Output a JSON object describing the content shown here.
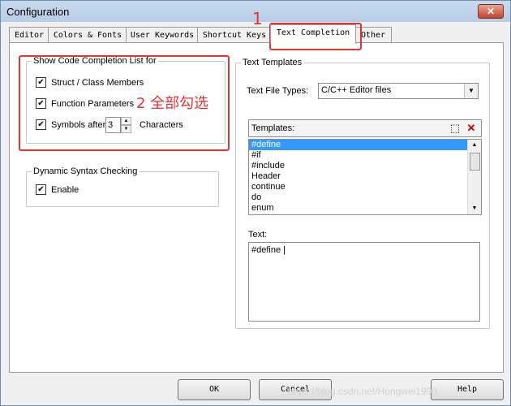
{
  "window": {
    "title": "Configuration",
    "close_symbol": "✕"
  },
  "tabs": [
    {
      "label": "Editor",
      "active": false
    },
    {
      "label": "Colors & Fonts",
      "active": false
    },
    {
      "label": "User Keywords",
      "active": false
    },
    {
      "label": "Shortcut Keys",
      "active": false
    },
    {
      "label": "Text Completion",
      "active": true
    },
    {
      "label": "Other",
      "active": false
    }
  ],
  "completion_group": {
    "legend": "Show Code Completion List for",
    "items": [
      {
        "label": "Struct / Class Members",
        "checked": true
      },
      {
        "label": "Function Parameters",
        "checked": true
      },
      {
        "label": "Symbols after",
        "checked": true
      }
    ],
    "symbols_count": "3",
    "characters_label": "Characters"
  },
  "syntax_group": {
    "legend": "Dynamic Syntax Checking",
    "enable_label": "Enable",
    "enable_checked": true
  },
  "templates_group": {
    "legend": "Text Templates",
    "file_types_label": "Text File Types:",
    "file_types_value": "C/C++ Editor files",
    "templates_label": "Templates:",
    "templates": [
      "#define",
      "#if",
      "#include",
      "Header",
      "continue",
      "do",
      "enum"
    ],
    "selected_template": "#define",
    "text_label": "Text:",
    "text_value": "#define |"
  },
  "buttons": {
    "ok": "OK",
    "cancel": "Cancel",
    "help": "Help"
  },
  "annotations": {
    "step1": "1",
    "step2": "2 全部勾选",
    "color": "#e53333"
  },
  "watermark": "https://blog.csdn.net/Hongwei1990"
}
